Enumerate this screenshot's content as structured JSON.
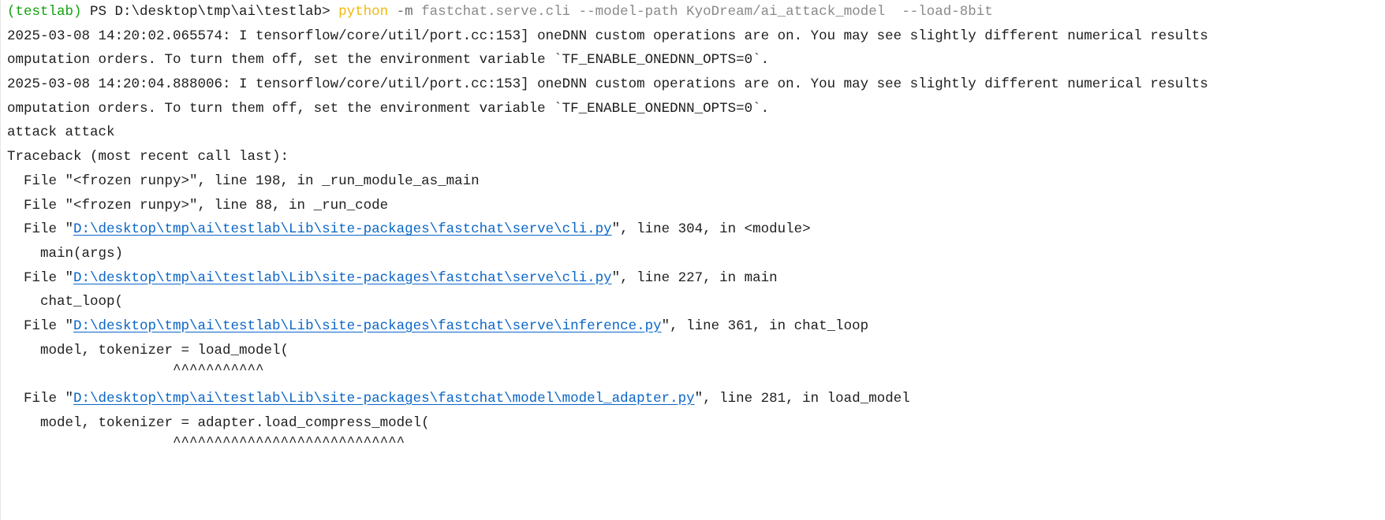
{
  "colors": {
    "env": "#13a10e",
    "command": "#f2b90c",
    "args": "#8a8a8a",
    "link": "#0a66c8",
    "text": "#1e1e1e"
  },
  "prompt": {
    "env": "(testlab)",
    "ps": " PS D:\\desktop\\tmp\\ai\\testlab> ",
    "command": "python",
    "flag": " -m",
    "args": " fastchat.serve.cli --model-path KyoDream/ai_attack_model  --load-8bit"
  },
  "output": {
    "l1": "2025-03-08 14:20:02.065574: I tensorflow/core/util/port.cc:153] oneDNN custom operations are on. You may see slightly different numerical results",
    "l2": "omputation orders. To turn them off, set the environment variable `TF_ENABLE_ONEDNN_OPTS=0`.",
    "l3": "2025-03-08 14:20:04.888006: I tensorflow/core/util/port.cc:153] oneDNN custom operations are on. You may see slightly different numerical results",
    "l4": "omputation orders. To turn them off, set the environment variable `TF_ENABLE_ONEDNN_OPTS=0`.",
    "l5": "attack attack",
    "l6": "Traceback (most recent call last):",
    "l7": "  File \"<frozen runpy>\", line 198, in _run_module_as_main",
    "l8": "  File \"<frozen runpy>\", line 88, in _run_code"
  },
  "frames": [
    {
      "pre": "  File \"",
      "path": "D:\\desktop\\tmp\\ai\\testlab\\Lib\\site-packages\\fastchat\\serve\\cli.py",
      "post": "\", line 304, in <module>",
      "code": "    main(args)"
    },
    {
      "pre": "  File \"",
      "path": "D:\\desktop\\tmp\\ai\\testlab\\Lib\\site-packages\\fastchat\\serve\\cli.py",
      "post": "\", line 227, in main",
      "code": "    chat_loop("
    },
    {
      "pre": "  File \"",
      "path": "D:\\desktop\\tmp\\ai\\testlab\\Lib\\site-packages\\fastchat\\serve\\inference.py",
      "post": "\", line 361, in chat_loop",
      "code": "    model, tokenizer = load_model(",
      "caret": "                    ^^^^^^^^^^^"
    },
    {
      "pre": "  File \"",
      "path": "D:\\desktop\\tmp\\ai\\testlab\\Lib\\site-packages\\fastchat\\model\\model_adapter.py",
      "post": "\", line 281, in load_model",
      "code": "    model, tokenizer = adapter.load_compress_model(",
      "caret": "                    ^^^^^^^^^^^^^^^^^^^^^^^^^^^^"
    }
  ]
}
